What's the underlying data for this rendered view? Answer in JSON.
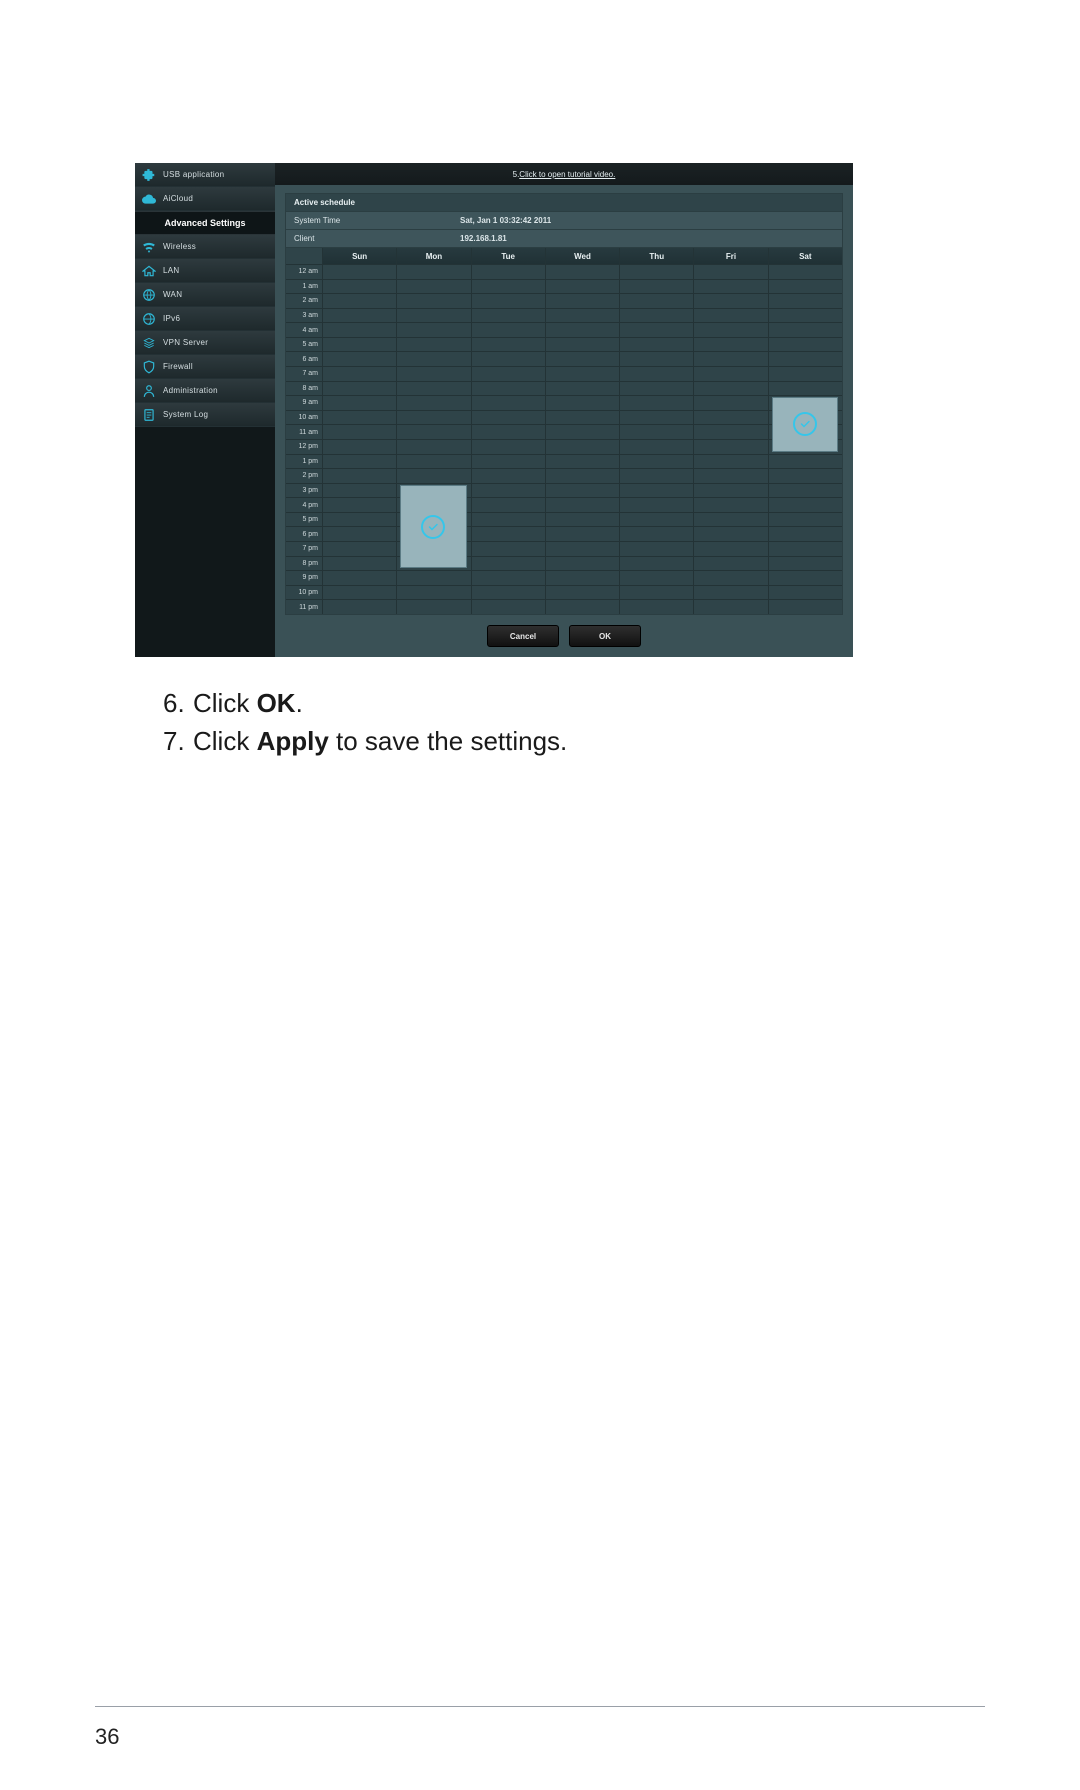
{
  "sidebar": {
    "items_top": [
      {
        "label": "USB application",
        "icon": "puzzle-icon"
      },
      {
        "label": "AiCloud",
        "icon": "cloud-icon"
      }
    ],
    "section_title": "Advanced Settings",
    "items_adv": [
      {
        "label": "Wireless",
        "icon": "wifi-icon"
      },
      {
        "label": "LAN",
        "icon": "home-icon"
      },
      {
        "label": "WAN",
        "icon": "globe-icon"
      },
      {
        "label": "IPv6",
        "icon": "globe-icon"
      },
      {
        "label": "VPN Server",
        "icon": "vpn-icon"
      },
      {
        "label": "Firewall",
        "icon": "shield-icon"
      },
      {
        "label": "Administration",
        "icon": "user-icon"
      },
      {
        "label": "System Log",
        "icon": "note-icon"
      }
    ]
  },
  "top_link_prefix": "5.  ",
  "top_link": "Click to open tutorial video.",
  "panel": {
    "title": "Active schedule",
    "system_time_label": "System Time",
    "system_time_value": "Sat, Jan 1   03:32:42 2011",
    "client_label": "Client",
    "client_value": "192.168.1.81"
  },
  "days": [
    "Sun",
    "Mon",
    "Tue",
    "Wed",
    "Thu",
    "Fri",
    "Sat"
  ],
  "hours": [
    "12 am",
    "1 am",
    "2 am",
    "3 am",
    "4 am",
    "5 am",
    "6 am",
    "7 am",
    "8 am",
    "9 am",
    "10 am",
    "11 am",
    "12 pm",
    "1 pm",
    "2 pm",
    "3 pm",
    "4 pm",
    "5 pm",
    "6 pm",
    "7 pm",
    "8 pm",
    "9 pm",
    "10 pm",
    "11 pm"
  ],
  "selections": [
    {
      "day": 1,
      "startHour": 15,
      "endHour": 21
    },
    {
      "day": 6,
      "startHour": 9,
      "endHour": 13
    }
  ],
  "buttons": {
    "cancel": "Cancel",
    "ok": "OK"
  },
  "instructions": [
    {
      "num": "6.",
      "pre": "Click ",
      "bold": "OK",
      "post": "."
    },
    {
      "num": "7.",
      "pre": "Click ",
      "bold": "Apply",
      "post": " to save the settings."
    }
  ],
  "page_number": "36"
}
